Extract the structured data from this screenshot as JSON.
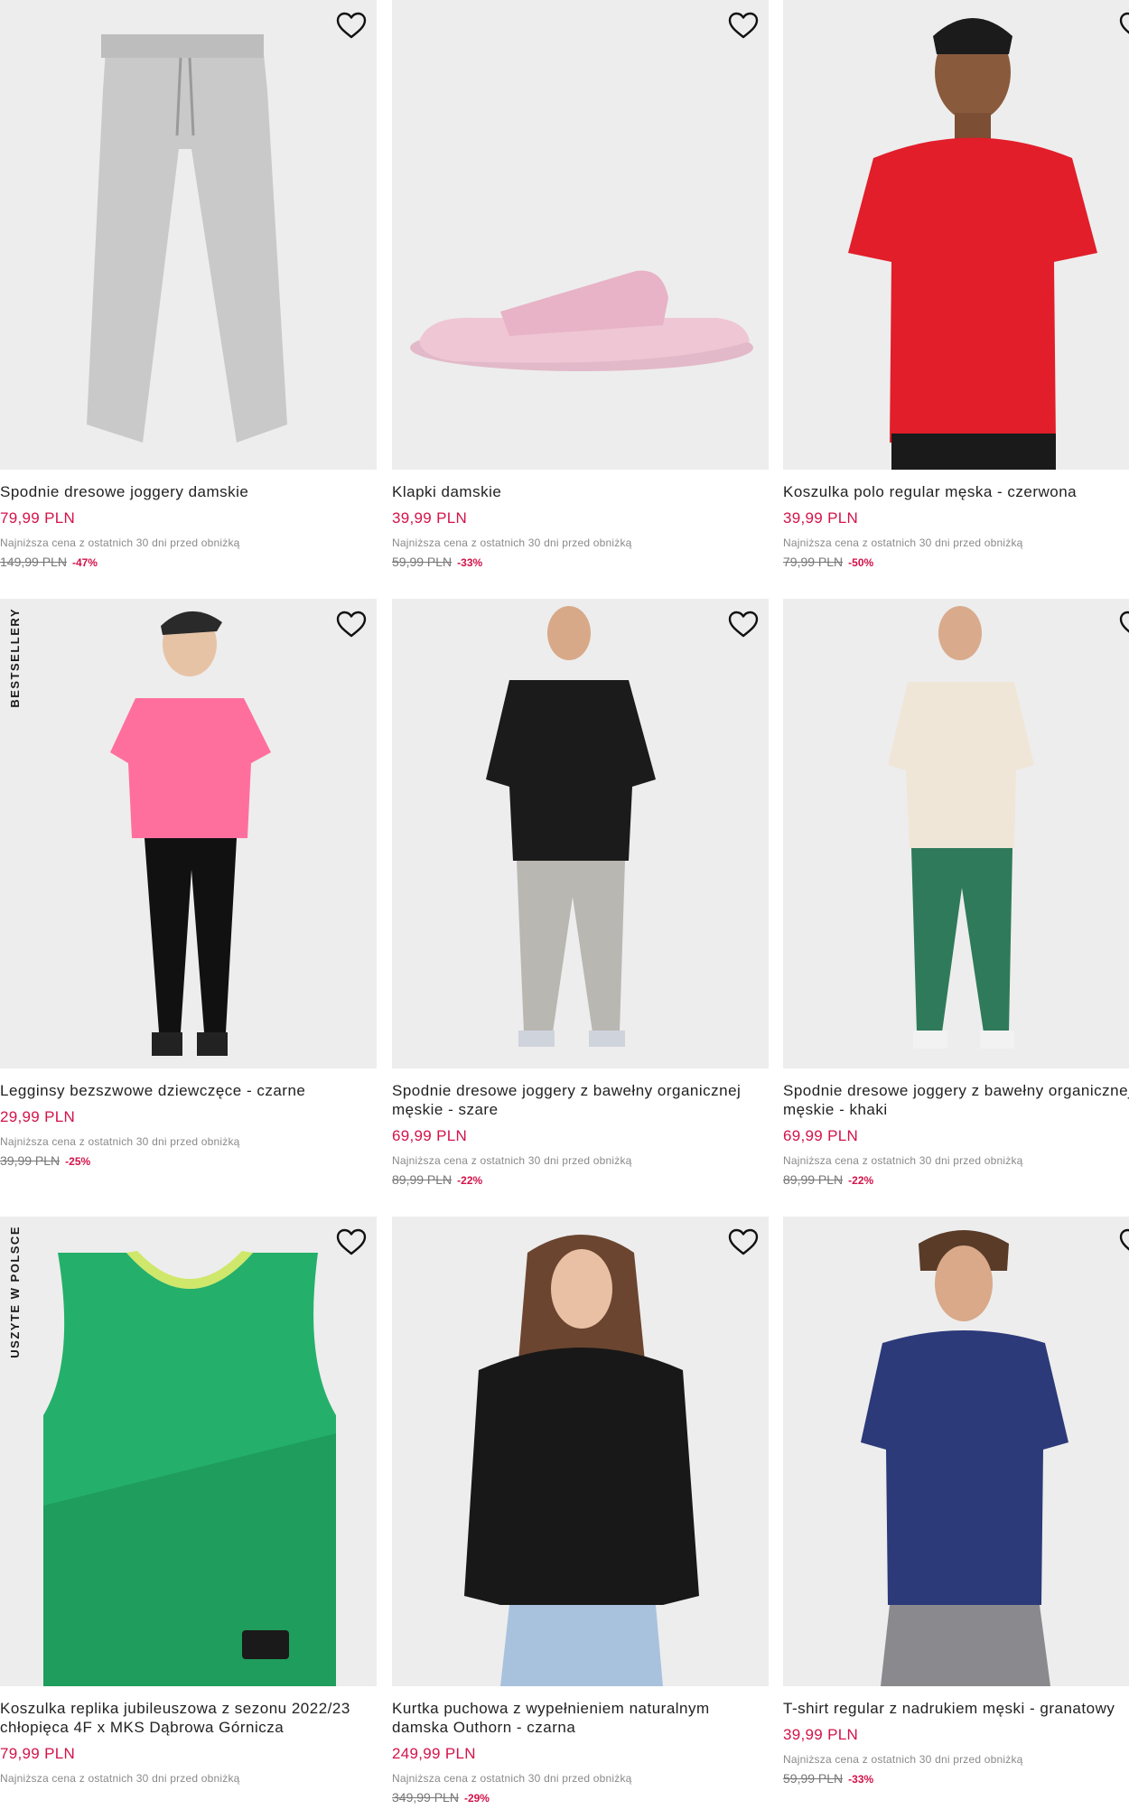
{
  "labels": {
    "lowest_price_note": "Najniższa cena z ostatnich 30 dni przed obniżką"
  },
  "icons": {
    "favorite": "heart-outline-icon"
  },
  "colors": {
    "price": "#d3134a",
    "placeholder": "#ececec"
  },
  "products": [
    {
      "name": "Spodnie dresowe joggery damskie",
      "price": "79,99 PLN",
      "old_price": "149,99 PLN",
      "discount": "-47%",
      "badge": ""
    },
    {
      "name": "Klapki damskie",
      "price": "39,99 PLN",
      "old_price": "59,99 PLN",
      "discount": "-33%",
      "badge": ""
    },
    {
      "name": "Koszulka polo regular męska - czerwona",
      "price": "39,99 PLN",
      "old_price": "79,99 PLN",
      "discount": "-50%",
      "badge": ""
    },
    {
      "name": "Legginsy bezszwowe dziewczęce - czarne",
      "price": "29,99 PLN",
      "old_price": "39,99 PLN",
      "discount": "-25%",
      "badge": "BESTSELLERY"
    },
    {
      "name": "Spodnie dresowe joggery z bawełny organicznej męskie - szare",
      "price": "69,99 PLN",
      "old_price": "89,99 PLN",
      "discount": "-22%",
      "badge": ""
    },
    {
      "name": "Spodnie dresowe joggery z bawełny organicznej męskie - khaki",
      "price": "69,99 PLN",
      "old_price": "89,99 PLN",
      "discount": "-22%",
      "badge": ""
    },
    {
      "name": "Koszulka replika jubileuszowa z sezonu 2022/23 chłopięca 4F x MKS Dąbrowa Górnicza",
      "price": "79,99 PLN",
      "old_price": "",
      "discount": "",
      "badge": "USZYTE W POLSCE"
    },
    {
      "name": "Kurtka puchowa z wypełnieniem naturalnym damska Outhorn - czarna",
      "price": "249,99 PLN",
      "old_price": "349,99 PLN",
      "discount": "-29%",
      "badge": ""
    },
    {
      "name": "T-shirt regular z nadrukiem męski - granatowy",
      "price": "39,99 PLN",
      "old_price": "59,99 PLN",
      "discount": "-33%",
      "badge": ""
    }
  ]
}
